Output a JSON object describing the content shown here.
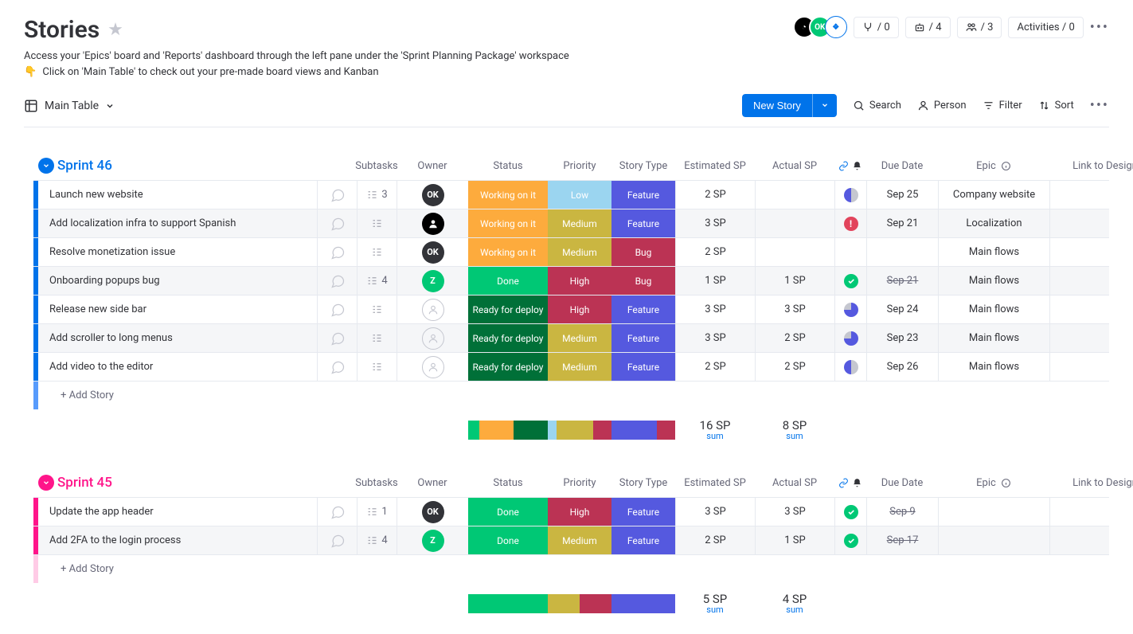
{
  "header": {
    "title": "Stories",
    "desc_line1": "Access your 'Epics' board and 'Reports' dashboard through the left pane under the 'Sprint Planning Package' workspace",
    "desc_line2": "Click on 'Main Table' to check out your pre-made board views and Kanban",
    "pointer_emoji": "👇"
  },
  "top_right": {
    "integration_count": "/ 0",
    "automation_count": "/ 4",
    "members_count": "/ 3",
    "activities_label": "Activities / 0"
  },
  "view": {
    "name": "Main Table"
  },
  "toolbar": {
    "new_story": "New Story",
    "search": "Search",
    "person": "Person",
    "filter": "Filter",
    "sort": "Sort"
  },
  "columns": {
    "subtasks": "Subtasks",
    "owner": "Owner",
    "status": "Status",
    "priority": "Priority",
    "story_type": "Story Type",
    "estimated_sp": "Estimated SP",
    "actual_sp": "Actual SP",
    "due_date": "Due Date",
    "epic": "Epic",
    "link_to_design": "Link to Design"
  },
  "add_story": "+ Add Story",
  "sum_label": "sum",
  "groups": [
    {
      "id": "sprint46",
      "title": "Sprint 46",
      "color_class": "blue",
      "rows": [
        {
          "name": "Launch new website",
          "subtasks": "3",
          "owner": {
            "type": "text",
            "label": "OK",
            "bg": "#323338"
          },
          "status": {
            "label": "Working on it",
            "color": "#fdab3d"
          },
          "priority": {
            "label": "Low",
            "color": "#9bd5f0"
          },
          "story_type": {
            "label": "Feature",
            "color": "#5559df"
          },
          "est": "2 SP",
          "act": "",
          "due_icon": "half",
          "due_date": "Sep 25",
          "epic": "Company website",
          "alt": false
        },
        {
          "name": "Add localization infra to support Spanish",
          "subtasks": "",
          "owner": {
            "type": "photo",
            "bg": "#000"
          },
          "status": {
            "label": "Working on it",
            "color": "#fdab3d"
          },
          "priority": {
            "label": "Medium",
            "color": "#cab641"
          },
          "story_type": {
            "label": "Feature",
            "color": "#5559df"
          },
          "est": "3 SP",
          "act": "",
          "due_icon": "alert",
          "due_date": "Sep 21",
          "epic": "Localization",
          "alt": true
        },
        {
          "name": "Resolve monetization issue",
          "subtasks": "",
          "owner": {
            "type": "text",
            "label": "OK",
            "bg": "#323338"
          },
          "status": {
            "label": "Working on it",
            "color": "#fdab3d"
          },
          "priority": {
            "label": "Medium",
            "color": "#cab641"
          },
          "story_type": {
            "label": "Bug",
            "color": "#bb3354"
          },
          "est": "2 SP",
          "act": "",
          "due_icon": "",
          "due_date": "",
          "epic": "Main flows",
          "alt": false
        },
        {
          "name": "Onboarding popups bug",
          "subtasks": "4",
          "owner": {
            "type": "text",
            "label": "Z",
            "bg": "#00c875"
          },
          "status": {
            "label": "Done",
            "color": "#00c875"
          },
          "priority": {
            "label": "High",
            "color": "#bb3354"
          },
          "story_type": {
            "label": "Bug",
            "color": "#bb3354"
          },
          "est": "1 SP",
          "act": "1 SP",
          "due_icon": "check",
          "due_date": "Sep 21",
          "due_strike": true,
          "epic": "Main flows",
          "alt": true
        },
        {
          "name": "Release new side bar",
          "subtasks": "",
          "owner": {
            "type": "empty"
          },
          "status": {
            "label": "Ready for deploy",
            "color": "#007038"
          },
          "priority": {
            "label": "High",
            "color": "#bb3354"
          },
          "story_type": {
            "label": "Feature",
            "color": "#5559df"
          },
          "est": "3 SP",
          "act": "3 SP",
          "due_icon": "three-quarter",
          "due_date": "Sep 24",
          "epic": "Main flows",
          "alt": false
        },
        {
          "name": "Add scroller to long menus",
          "subtasks": "",
          "owner": {
            "type": "empty"
          },
          "status": {
            "label": "Ready for deploy",
            "color": "#007038"
          },
          "priority": {
            "label": "Medium",
            "color": "#cab641"
          },
          "story_type": {
            "label": "Feature",
            "color": "#5559df"
          },
          "est": "3 SP",
          "act": "2 SP",
          "due_icon": "three-quarter",
          "due_date": "Sep 23",
          "epic": "Main flows",
          "alt": true
        },
        {
          "name": "Add video to the editor",
          "subtasks": "",
          "owner": {
            "type": "empty"
          },
          "status": {
            "label": "Ready for deploy",
            "color": "#007038"
          },
          "priority": {
            "label": "Medium",
            "color": "#cab641"
          },
          "story_type": {
            "label": "Feature",
            "color": "#5559df"
          },
          "est": "2 SP",
          "act": "2 SP",
          "due_icon": "half",
          "due_date": "Sep 26",
          "epic": "Main flows",
          "alt": false
        }
      ],
      "summary": {
        "est": "16 SP",
        "act": "8 SP",
        "status_segments": [
          {
            "color": "#00c875",
            "flex": 1
          },
          {
            "color": "#fdab3d",
            "flex": 3
          },
          {
            "color": "#007038",
            "flex": 3
          }
        ],
        "priority_segments": [
          {
            "color": "#9bd5f0",
            "flex": 1
          },
          {
            "color": "#cab641",
            "flex": 4
          },
          {
            "color": "#bb3354",
            "flex": 2
          }
        ],
        "type_segments": [
          {
            "color": "#5559df",
            "flex": 5
          },
          {
            "color": "#bb3354",
            "flex": 2
          }
        ]
      }
    },
    {
      "id": "sprint45",
      "title": "Sprint 45",
      "color_class": "pink",
      "rows": [
        {
          "name": "Update the app header",
          "subtasks": "1",
          "owner": {
            "type": "text",
            "label": "OK",
            "bg": "#323338"
          },
          "status": {
            "label": "Done",
            "color": "#00c875"
          },
          "priority": {
            "label": "High",
            "color": "#bb3354"
          },
          "story_type": {
            "label": "Feature",
            "color": "#5559df"
          },
          "est": "3 SP",
          "act": "3 SP",
          "due_icon": "check",
          "due_date": "Sep 9",
          "due_strike": true,
          "epic": "",
          "alt": false
        },
        {
          "name": "Add 2FA to the login process",
          "subtasks": "4",
          "owner": {
            "type": "text",
            "label": "Z",
            "bg": "#00c875"
          },
          "status": {
            "label": "Done",
            "color": "#00c875"
          },
          "priority": {
            "label": "Medium",
            "color": "#cab641"
          },
          "story_type": {
            "label": "Feature",
            "color": "#5559df"
          },
          "est": "2 SP",
          "act": "1 SP",
          "due_icon": "check",
          "due_date": "Sep 17",
          "due_strike": true,
          "epic": "",
          "alt": true
        }
      ],
      "summary": {
        "est": "5 SP",
        "act": "4 SP",
        "status_segments": [
          {
            "color": "#00c875",
            "flex": 1
          }
        ],
        "priority_segments": [
          {
            "color": "#cab641",
            "flex": 1
          },
          {
            "color": "#bb3354",
            "flex": 1
          }
        ],
        "type_segments": [
          {
            "color": "#5559df",
            "flex": 1
          }
        ]
      }
    }
  ]
}
